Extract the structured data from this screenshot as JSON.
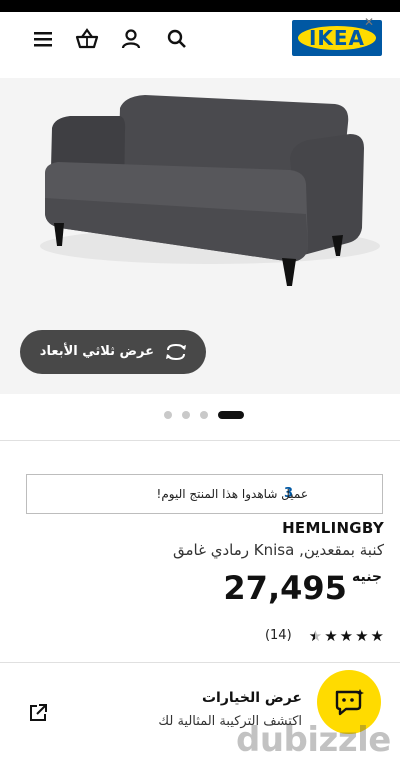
{
  "header": {
    "brand": "IKEA",
    "icons": [
      "menu-icon",
      "basket-icon",
      "user-icon",
      "search-icon"
    ]
  },
  "hero": {
    "view3d_label": "عرض ثلاثي الأبعاد",
    "carousel": {
      "count": 4,
      "active": 4
    }
  },
  "viewers": {
    "count": "3",
    "text": "عميل شاهدوا هذا المنتج اليوم!"
  },
  "product": {
    "name": "HEMLINGBY",
    "description": "كنبة بمقعدين, Knisa رمادي غامق",
    "price": "27,495",
    "currency": "جنيه",
    "rating": 4.5,
    "reviews": "(14)"
  },
  "options": {
    "title": "عرض الخيارات",
    "subtitle": "اكتشف التركيبة المثالية لك"
  },
  "watermark": "dubizzle",
  "colors": {
    "ikea_blue": "#0058a3",
    "ikea_yellow": "#ffdb00",
    "button_dark": "#484848"
  }
}
